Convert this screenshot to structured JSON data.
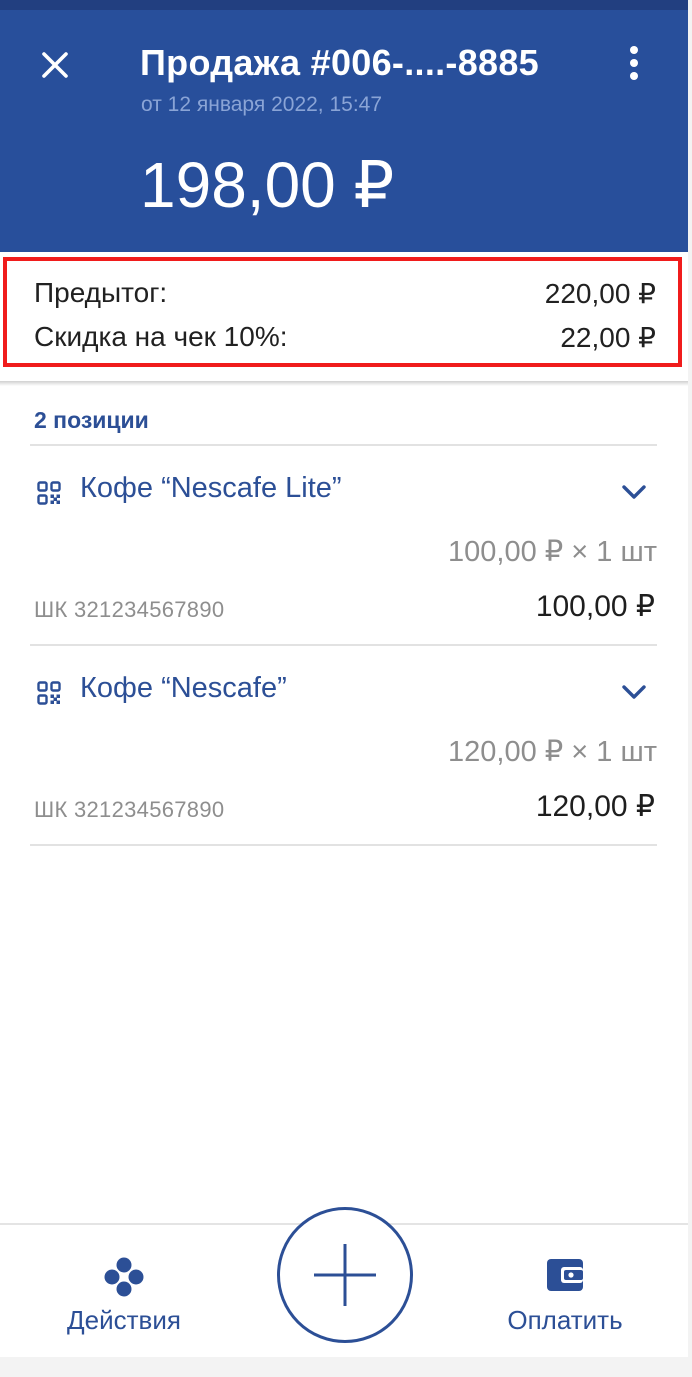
{
  "header": {
    "title": "Продажа #006-....-8885",
    "subtitle": "от 12 января 2022, 15:47",
    "total": "198,00 ₽"
  },
  "summary": {
    "subtotal_label": "Предытог:",
    "subtotal_value": "220,00 ₽",
    "discount_label": "Скидка на чек 10%:",
    "discount_value": "22,00 ₽"
  },
  "positions_label": "2 позиции",
  "items": [
    {
      "name": "Кофе “Nescafe Lite”",
      "price_qty": "100,00 ₽ × 1 шт",
      "barcode": "ШК 321234567890",
      "sum": "100,00 ₽"
    },
    {
      "name": "Кофе “Nescafe”",
      "price_qty": "120,00 ₽ × 1 шт",
      "barcode": "ШК 321234567890",
      "sum": "120,00 ₽"
    }
  ],
  "bottom_nav": {
    "actions_label": "Действия",
    "pay_label": "Оплатить"
  },
  "icons": {
    "close": "close-icon",
    "menu": "more-vertical-icon",
    "item_type": "qr-code-icon",
    "expand": "chevron-down-icon",
    "actions": "actions-dots-icon",
    "add": "plus-icon",
    "pay": "wallet-icon"
  },
  "colors": {
    "header_bg": "#284f9b",
    "accent": "#2c4f96",
    "highlight_border": "#f01c1c"
  }
}
